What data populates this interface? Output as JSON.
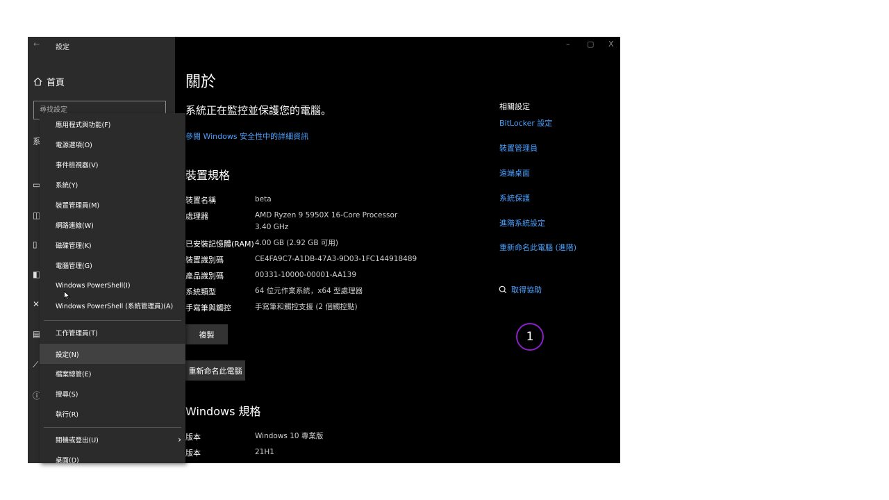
{
  "titlebar": {
    "back": "←",
    "title": "設定",
    "minimize": "–",
    "maximize": "▢",
    "close": "X"
  },
  "sidebar": {
    "home_label": "首頁",
    "search_placeholder": "尋找設定",
    "section_stub": "系"
  },
  "main": {
    "title": "關於",
    "monitor_text": "系統正在監控並保護您的電腦。",
    "security_link": "參閱 Windows 安全性中的詳細資訊",
    "device_specs_title": "裝置規格",
    "specs": [
      {
        "label": "裝置名稱",
        "value": "beta"
      },
      {
        "label": "處理器",
        "value": "AMD Ryzen 9 5950X 16-Core Processor",
        "value2": "3.40 GHz"
      },
      {
        "label": "已安裝記憶體(RAM)",
        "value": "4.00 GB (2.92 GB 可用)"
      },
      {
        "label": "裝置識別碼",
        "value": "CE4FA9C7-A1DB-47A3-9D03-1FC144918489"
      },
      {
        "label": "產品識別碼",
        "value": "00331-10000-00001-AA139"
      },
      {
        "label": "系統類型",
        "value": "64 位元作業系統，x64 型處理器"
      },
      {
        "label": "手寫筆與觸控",
        "value": "手寫筆和觸控支援 (2 個觸控點)"
      }
    ],
    "copy_button": "複製",
    "rename_button": "重新命名此電腦",
    "windows_specs_title": "Windows 規格",
    "win_specs": [
      {
        "label": "版本",
        "value": "Windows 10 專業版"
      },
      {
        "label": "版本",
        "value": "21H1"
      }
    ]
  },
  "related": {
    "title": "相關設定",
    "links": [
      "BitLocker 設定",
      "裝置管理員",
      "遠端桌面",
      "系統保護",
      "進階系統設定",
      "重新命名此電腦 (進階)"
    ],
    "help": "取得協助"
  },
  "context_menu": {
    "group1": [
      "應用程式與功能(F)",
      "電源選項(O)",
      "事件檢視器(V)",
      "系統(Y)",
      "裝置管理員(M)",
      "網路連線(W)",
      "磁碟管理(K)",
      "電腦管理(G)",
      "Windows PowerShell(I)",
      "Windows PowerShell (系統管理員)(A)"
    ],
    "group2": [
      "工作管理員(T)",
      "設定(N)",
      "檔案總管(E)",
      "搜尋(S)",
      "執行(R)"
    ],
    "group3": [
      "關機或登出(U)",
      "桌面(D)"
    ],
    "submenu_arrow": "›"
  },
  "badge": {
    "number": "1",
    "color": "#8b1fc9"
  },
  "colors": {
    "link": "#4aa2ff",
    "sidebar": "#2b2b2b",
    "menu_highlight": "#414141"
  }
}
